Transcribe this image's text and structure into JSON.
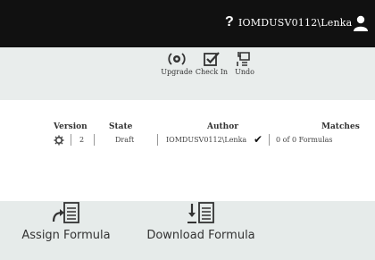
{
  "header": {
    "help_glyph": "?",
    "user": "IOMDUSV0112\\Lenka",
    "user_icon": "person-icon"
  },
  "toolbar": {
    "upgrade_label": "Upgrade",
    "checkin_label": "Check In",
    "undo_label": "Undo",
    "upgrade_icon": "upgrade-icon",
    "checkin_icon": "check-in-icon",
    "undo_icon": "undo-icon"
  },
  "table": {
    "headers": {
      "version": "Version",
      "state": "State",
      "author": "Author",
      "matches": "Matches"
    },
    "row": {
      "version": "2",
      "state": "Draft",
      "author": "IOMDUSV0112\\Lenka",
      "checked": "✔",
      "matches": "0 of 0 Formulas",
      "row_icon": "gear-icon"
    }
  },
  "actions": {
    "assign_label": "Assign Formula",
    "download_label": "Download Formula",
    "assign_icon": "assign-formula-icon",
    "download_icon": "download-formula-icon"
  }
}
